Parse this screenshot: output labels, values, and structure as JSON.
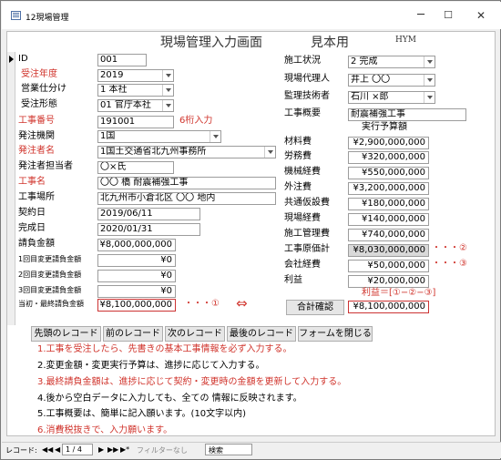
{
  "window": {
    "title": "12現場管理",
    "minimize": "─",
    "maximize": "☐",
    "close": "✕"
  },
  "header": {
    "title": "現場管理入力画面",
    "subtitle": "見本用",
    "code": "HYM"
  },
  "left_fields": {
    "id": {
      "label": "ID",
      "value": "001"
    },
    "year": {
      "label": "受注年度",
      "value": "2019"
    },
    "division": {
      "label": "営業仕分け",
      "value": "1 本社"
    },
    "order_type": {
      "label": "受注形態",
      "value": "01 官庁本社"
    },
    "work_no": {
      "label": "工事番号",
      "value": "191001",
      "note": "6桁入力"
    },
    "agency": {
      "label": "発注機関",
      "value": "1国"
    },
    "client": {
      "label": "発注者名",
      "value": "1国土交通省北九州事務所"
    },
    "client_person": {
      "label": "発注者担当者",
      "value": "〇×氏"
    },
    "work_name": {
      "label": "工事名",
      "value": "〇〇 橋 耐震補強工事"
    },
    "site": {
      "label": "工事場所",
      "value": "北九州市小倉北区 〇〇 地内"
    },
    "contract_date": {
      "label": "契約日",
      "value": "2019/06/11"
    },
    "completion_date": {
      "label": "完成日",
      "value": "2020/01/31"
    },
    "contract_amount": {
      "label": "請負金額",
      "value": "¥8,000,000,000"
    },
    "change1": {
      "label": "1回目変更請負金額",
      "value": "¥0"
    },
    "change2": {
      "label": "2回目変更請負金額",
      "value": "¥0"
    },
    "change3": {
      "label": "3回目変更請負金額",
      "value": "¥0"
    },
    "final": {
      "label": "当初・最終請負金額",
      "value": "¥8,100,000,000",
      "marker": "・・・①"
    }
  },
  "arrow": "⇔",
  "right_fields": {
    "status": {
      "label": "施工状況",
      "value": "2 完成"
    },
    "agent": {
      "label": "現場代理人",
      "value": "井上 〇〇"
    },
    "engineer": {
      "label": "監理技術者",
      "value": "石川 ×郎"
    },
    "summary": {
      "label": "工事概要",
      "value": "耐震補強工事"
    },
    "budget_heading": "実行予算額",
    "material": {
      "label": "材料費",
      "value": "¥2,900,000,000"
    },
    "labor": {
      "label": "労務費",
      "value": "¥320,000,000"
    },
    "machine": {
      "label": "機械経費",
      "value": "¥550,000,000"
    },
    "outsource": {
      "label": "外注費",
      "value": "¥3,200,000,000"
    },
    "temporary": {
      "label": "共通仮設費",
      "value": "¥180,000,000"
    },
    "site_cost": {
      "label": "現場経費",
      "value": "¥140,000,000"
    },
    "management": {
      "label": "施工管理費",
      "value": "¥740,000,000"
    },
    "cost_total": {
      "label": "工事原価計",
      "value": "¥8,030,000,000",
      "marker": "・・・②"
    },
    "company": {
      "label": "会社経費",
      "value": "¥50,000,000",
      "marker": "・・・③"
    },
    "profit": {
      "label": "利益",
      "value": "¥20,000,000"
    },
    "profit_formula": "利益＝[①−②−③]",
    "total_label": "合計確認",
    "total_value": "¥8,100,000,000"
  },
  "buttons": [
    "先頭のレコード",
    "前のレコード",
    "次のレコード",
    "最後のレコード",
    "フォームを閉じる"
  ],
  "notes": [
    {
      "text": "1.工事を受注したら、先書きの基本工事情報を必ず入力する。",
      "color": "#d0342c"
    },
    {
      "text": "2.変更金額・変更実行予算は、進捗に応じて入力する。",
      "color": "#000000"
    },
    {
      "text": "3.最終請負金額は、進捗に応じて契約・変更時の金額を更新して入力する。",
      "color": "#d0342c"
    },
    {
      "text": "4.後から空白データに入力しても、全ての 情報に反映されます。",
      "color": "#000000"
    },
    {
      "text": "5.工事概要は、簡単に記入願います。(10文字以内)",
      "color": "#000000"
    },
    {
      "text": "6.消費税抜きで、入力願います。",
      "color": "#d0342c"
    }
  ],
  "navbar": {
    "record_label": "レコード:",
    "first": "◀◀",
    "prev": "◀",
    "position": "1 / 4",
    "next": "▶",
    "last": "▶▶",
    "new": "▶*",
    "filter": "フィルターなし",
    "search": "検索"
  }
}
